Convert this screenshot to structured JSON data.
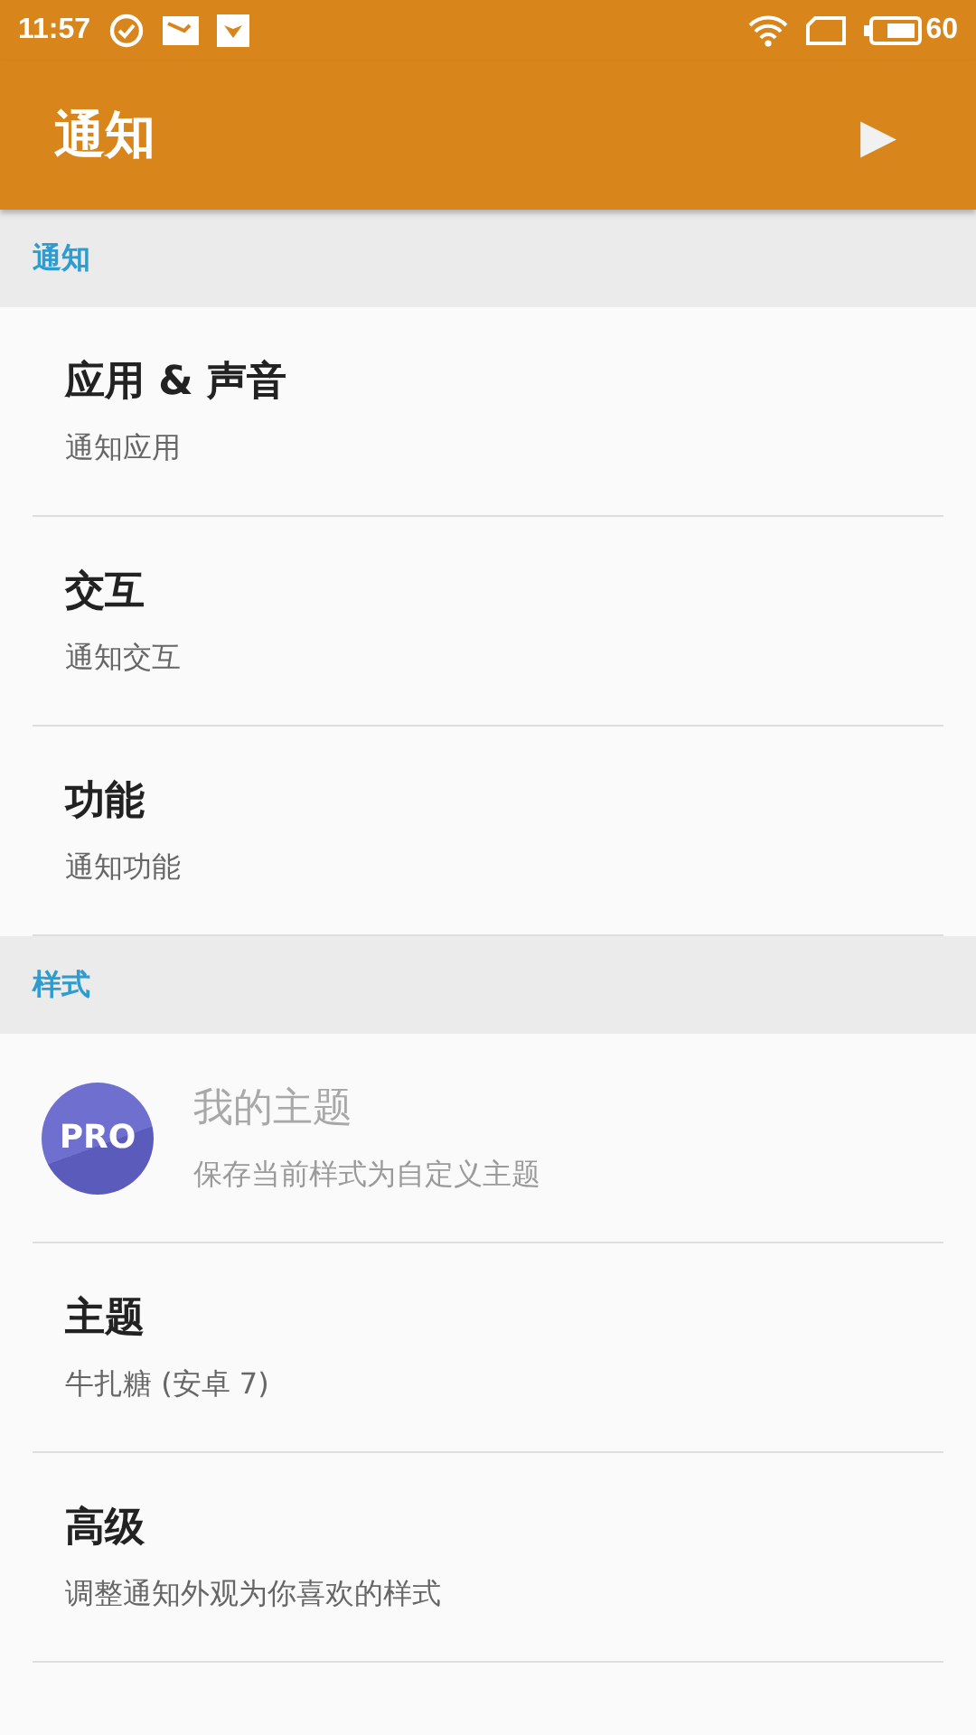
{
  "status_bar": {
    "time": "11:57",
    "battery": "60"
  },
  "toolbar": {
    "title": "通知",
    "action": "▶"
  },
  "sections": [
    {
      "title": "通知",
      "items": [
        {
          "kind": "text",
          "title": "应用 & 声音",
          "summary": "通知应用",
          "disabled": false
        },
        {
          "kind": "text",
          "title": "交互",
          "summary": "通知交互",
          "disabled": false
        },
        {
          "kind": "text",
          "title": "功能",
          "summary": "通知功能",
          "disabled": false
        }
      ]
    },
    {
      "title": "样式",
      "items": [
        {
          "kind": "badge",
          "badge": "PRO",
          "title": "我的主题",
          "summary": "保存当前样式为自定义主题",
          "disabled": true
        },
        {
          "kind": "text",
          "title": "主题",
          "summary": "牛扎糖 (安卓 7)",
          "disabled": false
        },
        {
          "kind": "text",
          "title": "高级",
          "summary": "调整通知外观为你喜欢的样式",
          "disabled": false
        }
      ]
    }
  ]
}
